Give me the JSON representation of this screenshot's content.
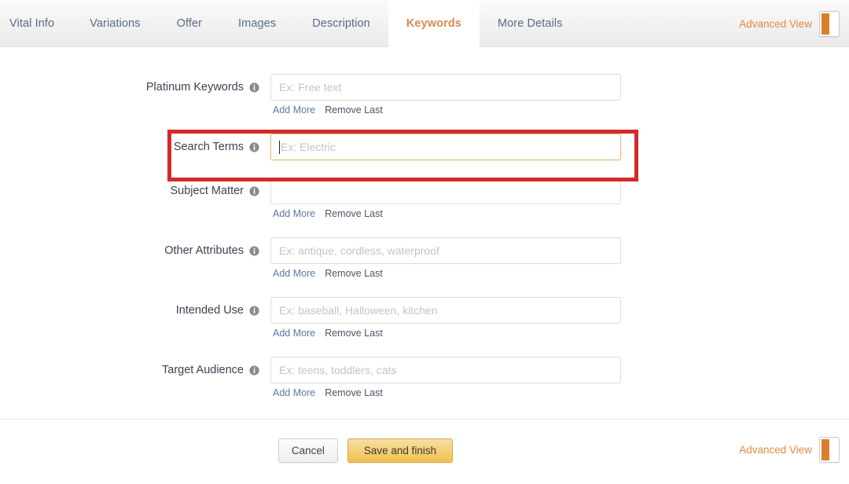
{
  "tabs": [
    {
      "label": "Vital Info",
      "active": false
    },
    {
      "label": "Variations",
      "active": false
    },
    {
      "label": "Offer",
      "active": false
    },
    {
      "label": "Images",
      "active": false
    },
    {
      "label": "Description",
      "active": false
    },
    {
      "label": "Keywords",
      "active": true
    },
    {
      "label": "More Details",
      "active": false
    }
  ],
  "advanced_view": {
    "label": "Advanced View",
    "toggle_state": "on",
    "accent_color": "#d97f2e",
    "label_color": "#e08c3e"
  },
  "form": {
    "add_more_label": "Add More",
    "remove_last_label": "Remove Last",
    "info_icon": "info-icon",
    "fields": [
      {
        "label": "Platinum Keywords",
        "placeholder": "Ex: Free text",
        "value": "",
        "focused": false,
        "has_links": true
      },
      {
        "label": "Search Terms",
        "placeholder": "Ex: Electric",
        "value": "",
        "focused": true,
        "has_links": false,
        "highlighted": true
      },
      {
        "label": "Subject Matter",
        "placeholder": "",
        "value": "",
        "focused": false,
        "has_links": true
      },
      {
        "label": "Other Attributes",
        "placeholder": "Ex: antique, cordless, waterproof",
        "value": "",
        "focused": false,
        "has_links": true
      },
      {
        "label": "Intended Use",
        "placeholder": "Ex: baseball, Halloween, kitchen",
        "value": "",
        "focused": false,
        "has_links": true
      },
      {
        "label": "Target Audience",
        "placeholder": "Ex: teens, toddlers, cats",
        "value": "",
        "focused": false,
        "has_links": true
      }
    ]
  },
  "footer": {
    "cancel_label": "Cancel",
    "save_label": "Save and finish",
    "save_color": "#f0c14b"
  },
  "annotation": {
    "type": "highlight-rectangle",
    "color": "#d32b2b",
    "target": "Search Terms"
  }
}
